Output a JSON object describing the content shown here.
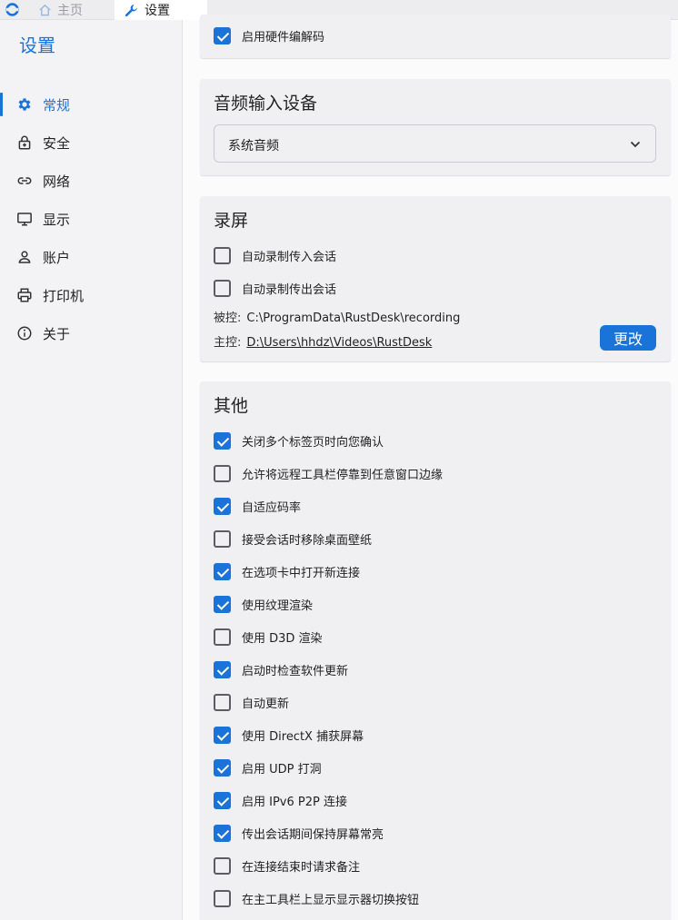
{
  "tabs": {
    "home": "主页",
    "settings": "设置"
  },
  "sidebar": {
    "title": "设置",
    "items": [
      {
        "label": "常规",
        "icon": "gear-icon",
        "active": true
      },
      {
        "label": "安全",
        "icon": "lock-icon"
      },
      {
        "label": "网络",
        "icon": "link-icon"
      },
      {
        "label": "显示",
        "icon": "monitor-icon"
      },
      {
        "label": "账户",
        "icon": "person-icon"
      },
      {
        "label": "打印机",
        "icon": "printer-icon"
      },
      {
        "label": "关于",
        "icon": "info-icon"
      }
    ]
  },
  "hw_card": {
    "options": [
      {
        "label": "启用硬件编解码",
        "checked": true
      }
    ]
  },
  "audio": {
    "title": "音频输入设备",
    "selected": "系统音频"
  },
  "recording": {
    "title": "录屏",
    "options": [
      {
        "label": "自动录制传入会话",
        "checked": false
      },
      {
        "label": "自动录制传出会话",
        "checked": false
      }
    ],
    "controlled_label": "被控:",
    "controlled_path": "C:\\ProgramData\\RustDesk\\recording",
    "controller_label": "主控:",
    "controller_path": "D:\\Users\\hhdz\\Videos\\RustDesk",
    "change_button": "更改"
  },
  "other": {
    "title": "其他",
    "options": [
      {
        "label": "关闭多个标签页时向您确认",
        "checked": true
      },
      {
        "label": "允许将远程工具栏停靠到任意窗口边缘",
        "checked": false
      },
      {
        "label": "自适应码率",
        "checked": true
      },
      {
        "label": "接受会话时移除桌面壁纸",
        "checked": false
      },
      {
        "label": "在选项卡中打开新连接",
        "checked": true
      },
      {
        "label": "使用纹理渲染",
        "checked": true
      },
      {
        "label": "使用 D3D 渲染",
        "checked": false
      },
      {
        "label": "启动时检查软件更新",
        "checked": true
      },
      {
        "label": "自动更新",
        "checked": false
      },
      {
        "label": "使用 DirectX 捕获屏幕",
        "checked": true
      },
      {
        "label": "启用 UDP 打洞",
        "checked": true
      },
      {
        "label": "启用 IPv6 P2P 连接",
        "checked": true
      },
      {
        "label": "传出会话期间保持屏幕常亮",
        "checked": true
      },
      {
        "label": "在连接结束时请求备注",
        "checked": false
      },
      {
        "label": "在主工具栏上显示显示器切换按钮",
        "checked": false
      }
    ]
  },
  "colors": {
    "accent": "#1a73d9"
  }
}
